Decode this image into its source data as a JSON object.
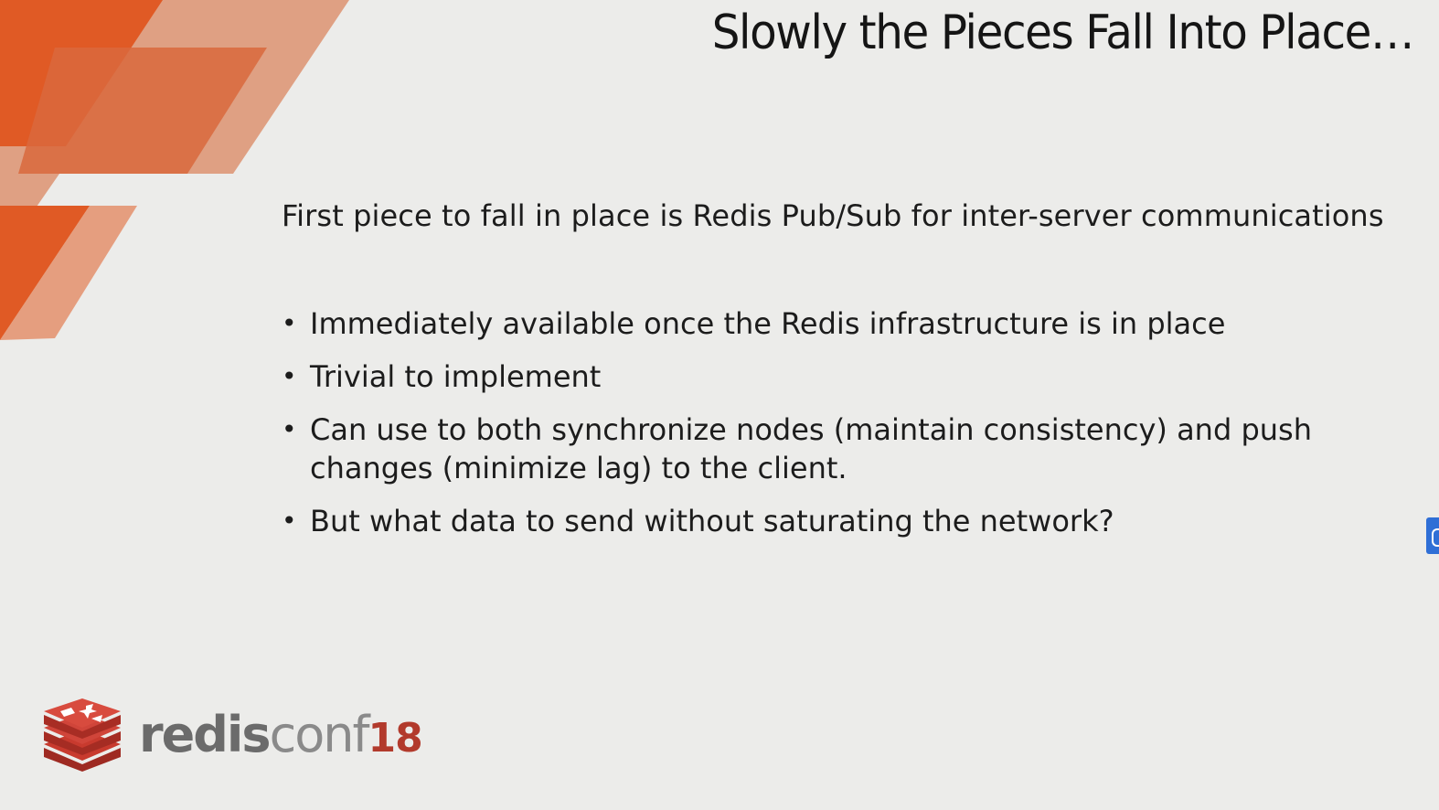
{
  "slide": {
    "title": "Slowly the Pieces Fall Into Place…",
    "intro": "First piece to fall in place is  Redis Pub/Sub for inter-server communications",
    "bullet_glyph": "•",
    "bullets": [
      "Immediately available once the Redis infrastructure is in place",
      "Trivial to implement",
      "Can use to both synchronize nodes (maintain consistency) and push changes (minimize lag) to the client.",
      "But what data to send without saturating the network?"
    ]
  },
  "logo": {
    "icon": "redis-cube-icon",
    "redis": "redis",
    "conf": "conf",
    "year": "18"
  },
  "colors": {
    "accent_dark": "#d9481b",
    "accent_mid": "#e06535",
    "accent_light": "#df9a78",
    "logo_red": "#b23a2c",
    "background": "#ececea"
  }
}
